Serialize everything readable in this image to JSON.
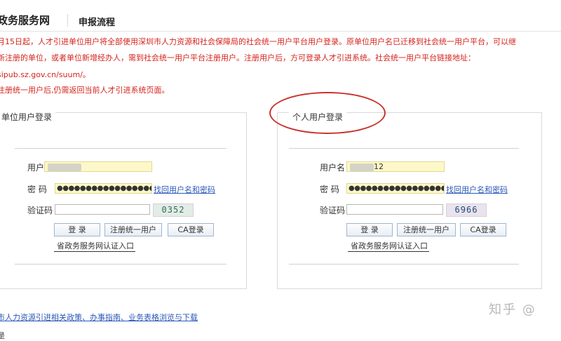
{
  "header": {
    "site_title": "政务服务网",
    "nav_link": "申报流程"
  },
  "notice": {
    "line1": "月15日起，人才引进单位用户将全部使用深圳市人力资源和社会保障局的社会统一用户平台用户登录。原单位用户名已迁移到社会统一用户平台，可以继",
    "line2": "新注册的单位，或者单位新增经办人，需到社会统一用户平台注册用户。注册用户后，方可登录人才引进系统。社会统一用户平台链接地址：",
    "line3_link": "sipub.sz.gov.cn/suum/",
    "line3_suffix": "。",
    "line4": "注册统一用户后,仍需返回当前人才引进系统页面。"
  },
  "unit_login": {
    "title": "单位用户登录",
    "username_label": "用户",
    "password_label": "密  码",
    "password_value": "●●●●●●●●●●●●●●●●●●●●",
    "find_link": "找回用户名和密码",
    "captcha_label": "验证码",
    "captcha_value": "0352",
    "login_button": "登 录",
    "register_button": "注册统一用户",
    "ca_button": "CA登录",
    "cert_link": "省政务服务网认证入口"
  },
  "personal_login": {
    "title": "个人用户登录",
    "username_label": "用户名",
    "username_suffix": "12",
    "password_label": "密  码",
    "password_value": "●●●●●●●●●●●●●●●●●●●●",
    "find_link": "找回用户名和密码",
    "captcha_label": "验证码",
    "captcha_value": "6966",
    "login_button": "登 录",
    "register_button": "注册统一用户",
    "ca_button": "CA登录",
    "cert_link": "省政务服务网认证入口"
  },
  "footer": {
    "policy_link": "市人力资源引进相关政策、办事指南、业务表格浏览与下载",
    "watermark": "知乎 @",
    "bottom_text": "是"
  },
  "colors": {
    "notice_red": "#d4241d",
    "link_blue": "#2a58b8",
    "highlight_red": "#c8332c",
    "input_yellow": "#fdf8c9"
  }
}
